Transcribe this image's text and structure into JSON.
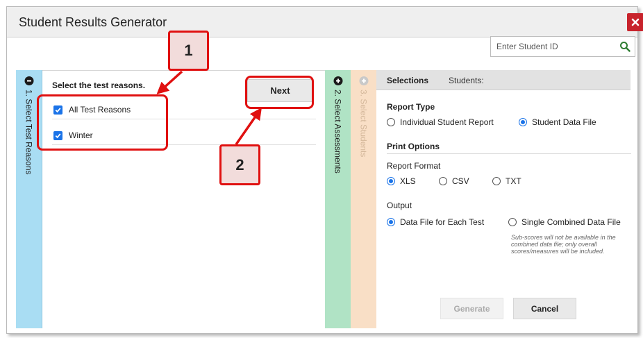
{
  "dialog": {
    "title": "Student Results Generator",
    "close_icon": "close-icon",
    "close_color": "#c8232c"
  },
  "search": {
    "placeholder": "Enter Student ID",
    "icon": "search-icon",
    "icon_color": "#2e7d32"
  },
  "tabs": [
    {
      "label": "1. Select Test Reasons",
      "icon": "minus-circle-icon",
      "color": "#a9ddf3"
    },
    {
      "label": "2. Select Assessments",
      "icon": "plus-circle-icon",
      "color": "#b0e3c5"
    },
    {
      "label": "3. Select Students",
      "icon": "plus-circle-icon",
      "color": "#f9dfc6"
    }
  ],
  "left_panel": {
    "heading": "Select the test reasons.",
    "next_label": "Next",
    "options": [
      {
        "label": "All Test Reasons",
        "checked": true
      },
      {
        "label": "Winter",
        "checked": true
      }
    ]
  },
  "selections": {
    "title": "Selections",
    "students_label": "Students:",
    "report_type": {
      "title": "Report Type",
      "options": [
        {
          "label": "Individual Student Report",
          "selected": false
        },
        {
          "label": "Student Data File",
          "selected": true
        }
      ]
    },
    "print_options": {
      "title": "Print Options",
      "report_format": {
        "title": "Report Format",
        "options": [
          {
            "label": "XLS",
            "selected": true
          },
          {
            "label": "CSV",
            "selected": false
          },
          {
            "label": "TXT",
            "selected": false
          }
        ]
      },
      "output": {
        "title": "Output",
        "options": [
          {
            "label": "Data File for Each Test",
            "selected": true
          },
          {
            "label": "Single Combined Data File",
            "selected": false
          }
        ],
        "note": "Sub-scores will not be available in the combined data file; only overall scores/measures will be included."
      }
    },
    "generate_label": "Generate",
    "cancel_label": "Cancel"
  },
  "callouts": [
    {
      "number": "1"
    },
    {
      "number": "2"
    }
  ],
  "colors": {
    "accent": "#1a73e8",
    "annotation": "#e01010",
    "callout_fill": "#f2dcdb"
  }
}
